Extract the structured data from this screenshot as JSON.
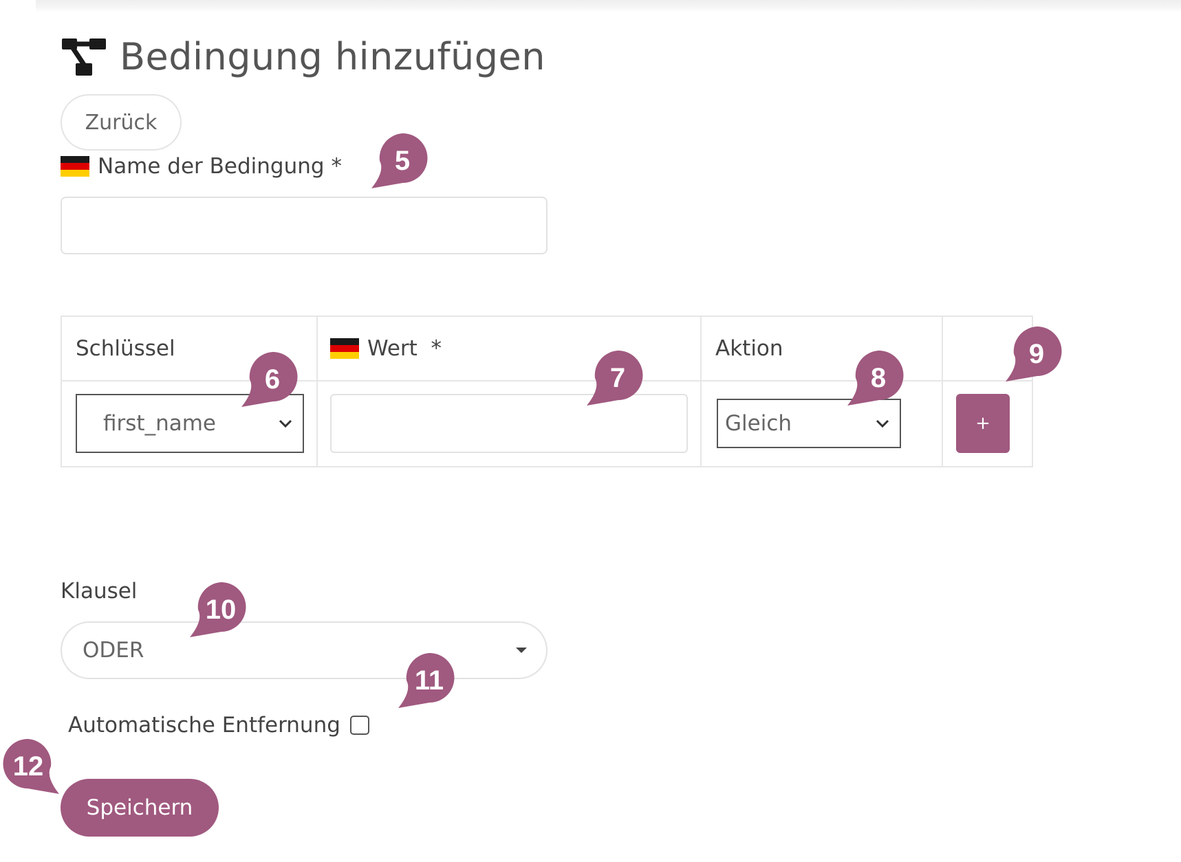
{
  "page": {
    "title": "Bedingung hinzufügen",
    "title_icon": "sitemap-icon",
    "back_label": "Zurück"
  },
  "name_field": {
    "label": "Name der Bedingung *",
    "flag": "german-flag-icon",
    "value": ""
  },
  "condition_table": {
    "headers": {
      "key": "Schlüssel",
      "value": "Wert  *",
      "action": "Aktion"
    },
    "row": {
      "key_selected": "first_name",
      "value": "",
      "action_selected": "Gleich",
      "add_label": "+"
    }
  },
  "clause": {
    "label": "Klausel",
    "selected": "ODER"
  },
  "auto_remove": {
    "label": "Automatische Entfernung",
    "checked": false
  },
  "save_label": "Speichern",
  "markers": [
    "5",
    "6",
    "7",
    "8",
    "9",
    "10",
    "11",
    "12"
  ],
  "colors": {
    "accent": "#a0597f",
    "border": "#e2e2e2",
    "text": "#444444"
  }
}
